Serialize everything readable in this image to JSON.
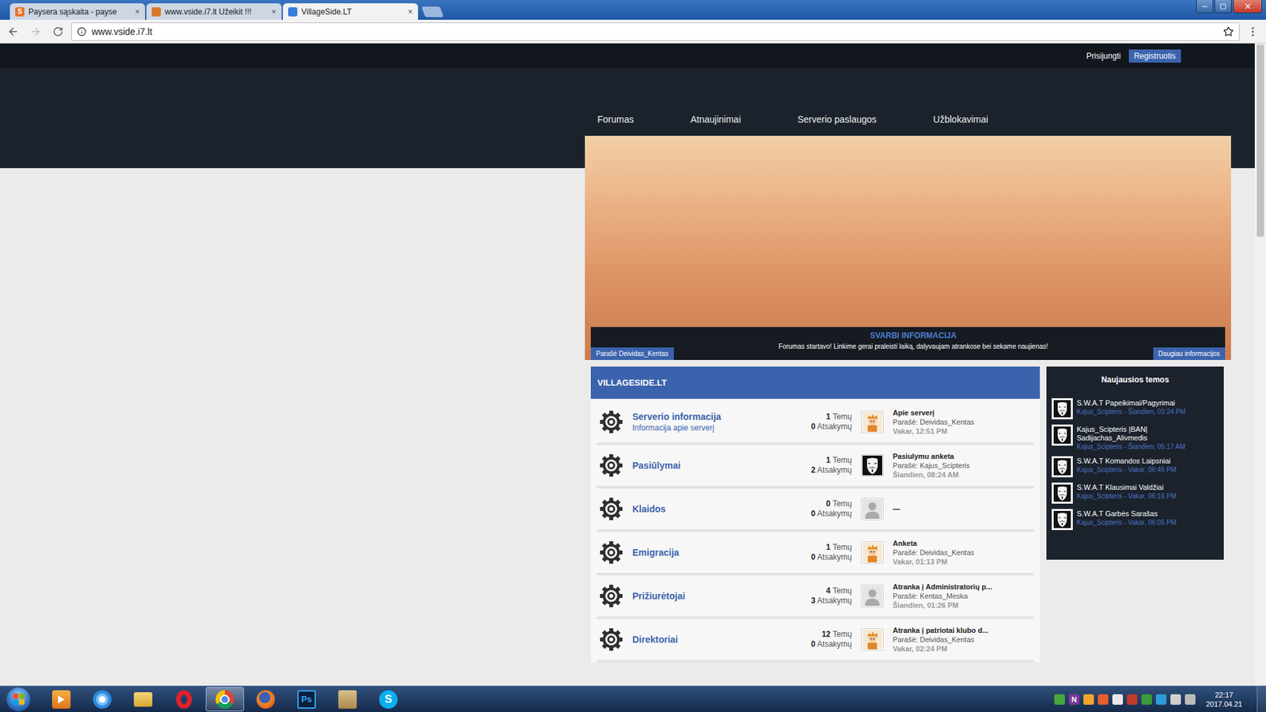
{
  "browser": {
    "tabs": [
      {
        "title": "Paysera sąskaita - payse",
        "favicon": "S",
        "favicon_color": "#e8702a",
        "selected": false
      },
      {
        "title": "www.vside.i7.lt Užeikit !!!",
        "favicon": "",
        "favicon_color": "#d9792c",
        "selected": false
      },
      {
        "title": "VillageSide.LT",
        "favicon": "",
        "favicon_color": "#3b7dd8",
        "selected": true
      }
    ],
    "tab_close": "×",
    "url": "www.vside.i7.lt"
  },
  "topbar": {
    "login": "Prisijungti",
    "register": "Registruotis"
  },
  "nav": [
    {
      "label": "Forumas"
    },
    {
      "label": "Atnaujinimai"
    },
    {
      "label": "Serverio paslaugos"
    },
    {
      "label": "Užblokavimai"
    }
  ],
  "announcement": {
    "title": "SVARBI INFORMACIJA",
    "text": "Forumas startavo! Linkime gerai praleisti laiką, dalyvaujam atrankose bei sekame naujienas!",
    "author": "Parašė Deividas_Kentas",
    "more": "Daugiau informacijos"
  },
  "forum": {
    "title": "VILLAGESIDE.LT",
    "rows": [
      {
        "name": "Serverio informacija",
        "description": "Informacija apie serverį",
        "topics": "1",
        "topics_label": "Temų",
        "replies": "0",
        "replies_label": "Atsakymų",
        "last_title": "Apie serverį",
        "last_author": "Parašė: Deividas_Kentas",
        "last_time": "Vakar, 12:51 PM",
        "avatar": "character"
      },
      {
        "name": "Pasiūlymai",
        "description": "",
        "topics": "1",
        "topics_label": "Temų",
        "replies": "2",
        "replies_label": "Atsakymų",
        "last_title": "Pasiulymu anketa",
        "last_author": "Parašė: Kajus_Scipteris",
        "last_time": "Šiandien, 08:24 AM",
        "avatar": "mask"
      },
      {
        "name": "Klaidos",
        "description": "",
        "topics": "0",
        "topics_label": "Temų",
        "replies": "0",
        "replies_label": "Atsakymų",
        "last_title": "—",
        "last_author": "",
        "last_time": "",
        "avatar": "none"
      },
      {
        "name": "Emigracija",
        "description": "",
        "topics": "1",
        "topics_label": "Temų",
        "replies": "0",
        "replies_label": "Atsakymų",
        "last_title": "Anketa",
        "last_author": "Parašė: Deividas_Kentas",
        "last_time": "Vakar, 01:13 PM",
        "avatar": "character"
      },
      {
        "name": "Prižiurėtojai",
        "description": "",
        "topics": "4",
        "topics_label": "Temų",
        "replies": "3",
        "replies_label": "Atsakymų",
        "last_title": "Atranka į Administratorių p...",
        "last_author": "Parašė: Kentas_Meska",
        "last_time": "Šiandien, 01:26 PM",
        "avatar": "none"
      },
      {
        "name": "Direktoriai",
        "description": "",
        "topics": "12",
        "topics_label": "Temų",
        "replies": "0",
        "replies_label": "Atsakymų",
        "last_title": "Atranka į patriotai klubo d...",
        "last_author": "Parašė: Deividas_Kentas",
        "last_time": "Vakar, 02:24 PM",
        "avatar": "character"
      }
    ]
  },
  "sidebar": {
    "title": "Naujausios temos",
    "items": [
      {
        "title": "S.W.A.T Papeikimai/Pagyrimai",
        "meta": "Kajus_Scipteris - Šiandien, 03:24 PM"
      },
      {
        "title": "Kajus_Scipteris |BAN| Sadijachas_Alivmedis",
        "meta": "Kajus_Scipteris - Šiandien, 05:17 AM"
      },
      {
        "title": "S.W.A.T Komandos Laipsniai",
        "meta": "Kajus_Scipteris - Vakar, 06:45 PM"
      },
      {
        "title": "S.W.A.T Klausimai Valdžiai",
        "meta": "Kajus_Scipteris - Vakar, 06:16 PM"
      },
      {
        "title": "S.W.A.T Garbės Sarašas",
        "meta": "Kajus_Scipteris - Vakar, 06:05 PM"
      }
    ]
  },
  "scrollbar": {
    "level": 0.3
  },
  "taskbar": {
    "apps": [
      {
        "kind": "media",
        "label": "",
        "selected": false
      },
      {
        "kind": "ie",
        "label": "",
        "selected": false
      },
      {
        "kind": "explorer",
        "label": "",
        "selected": false
      },
      {
        "kind": "opera",
        "label": "",
        "selected": false
      },
      {
        "kind": "chrome",
        "label": "",
        "selected": true
      },
      {
        "kind": "firefox",
        "label": "",
        "selected": false
      },
      {
        "kind": "photoshop",
        "label": "Ps",
        "selected": false
      },
      {
        "kind": "archive",
        "label": "",
        "selected": false
      },
      {
        "kind": "skype",
        "label": "S",
        "selected": false
      }
    ],
    "tray": [
      {
        "label": "",
        "color": "#46a83c"
      },
      {
        "label": "N",
        "color": "#7b3a9c"
      },
      {
        "label": "",
        "color": "#f2a42b"
      },
      {
        "label": "",
        "color": "#e85d2a"
      },
      {
        "label": "",
        "color": "#e8e8e8"
      },
      {
        "label": "",
        "color": "#c0392b"
      },
      {
        "label": "",
        "color": "#3a9a3a"
      },
      {
        "label": "",
        "color": "#2e9cd6"
      },
      {
        "label": "",
        "color": "#d0d0d0"
      },
      {
        "label": "",
        "color": "#bcbcbc"
      }
    ],
    "clock": {
      "time": "22:17",
      "date": "2017.04.21"
    }
  }
}
